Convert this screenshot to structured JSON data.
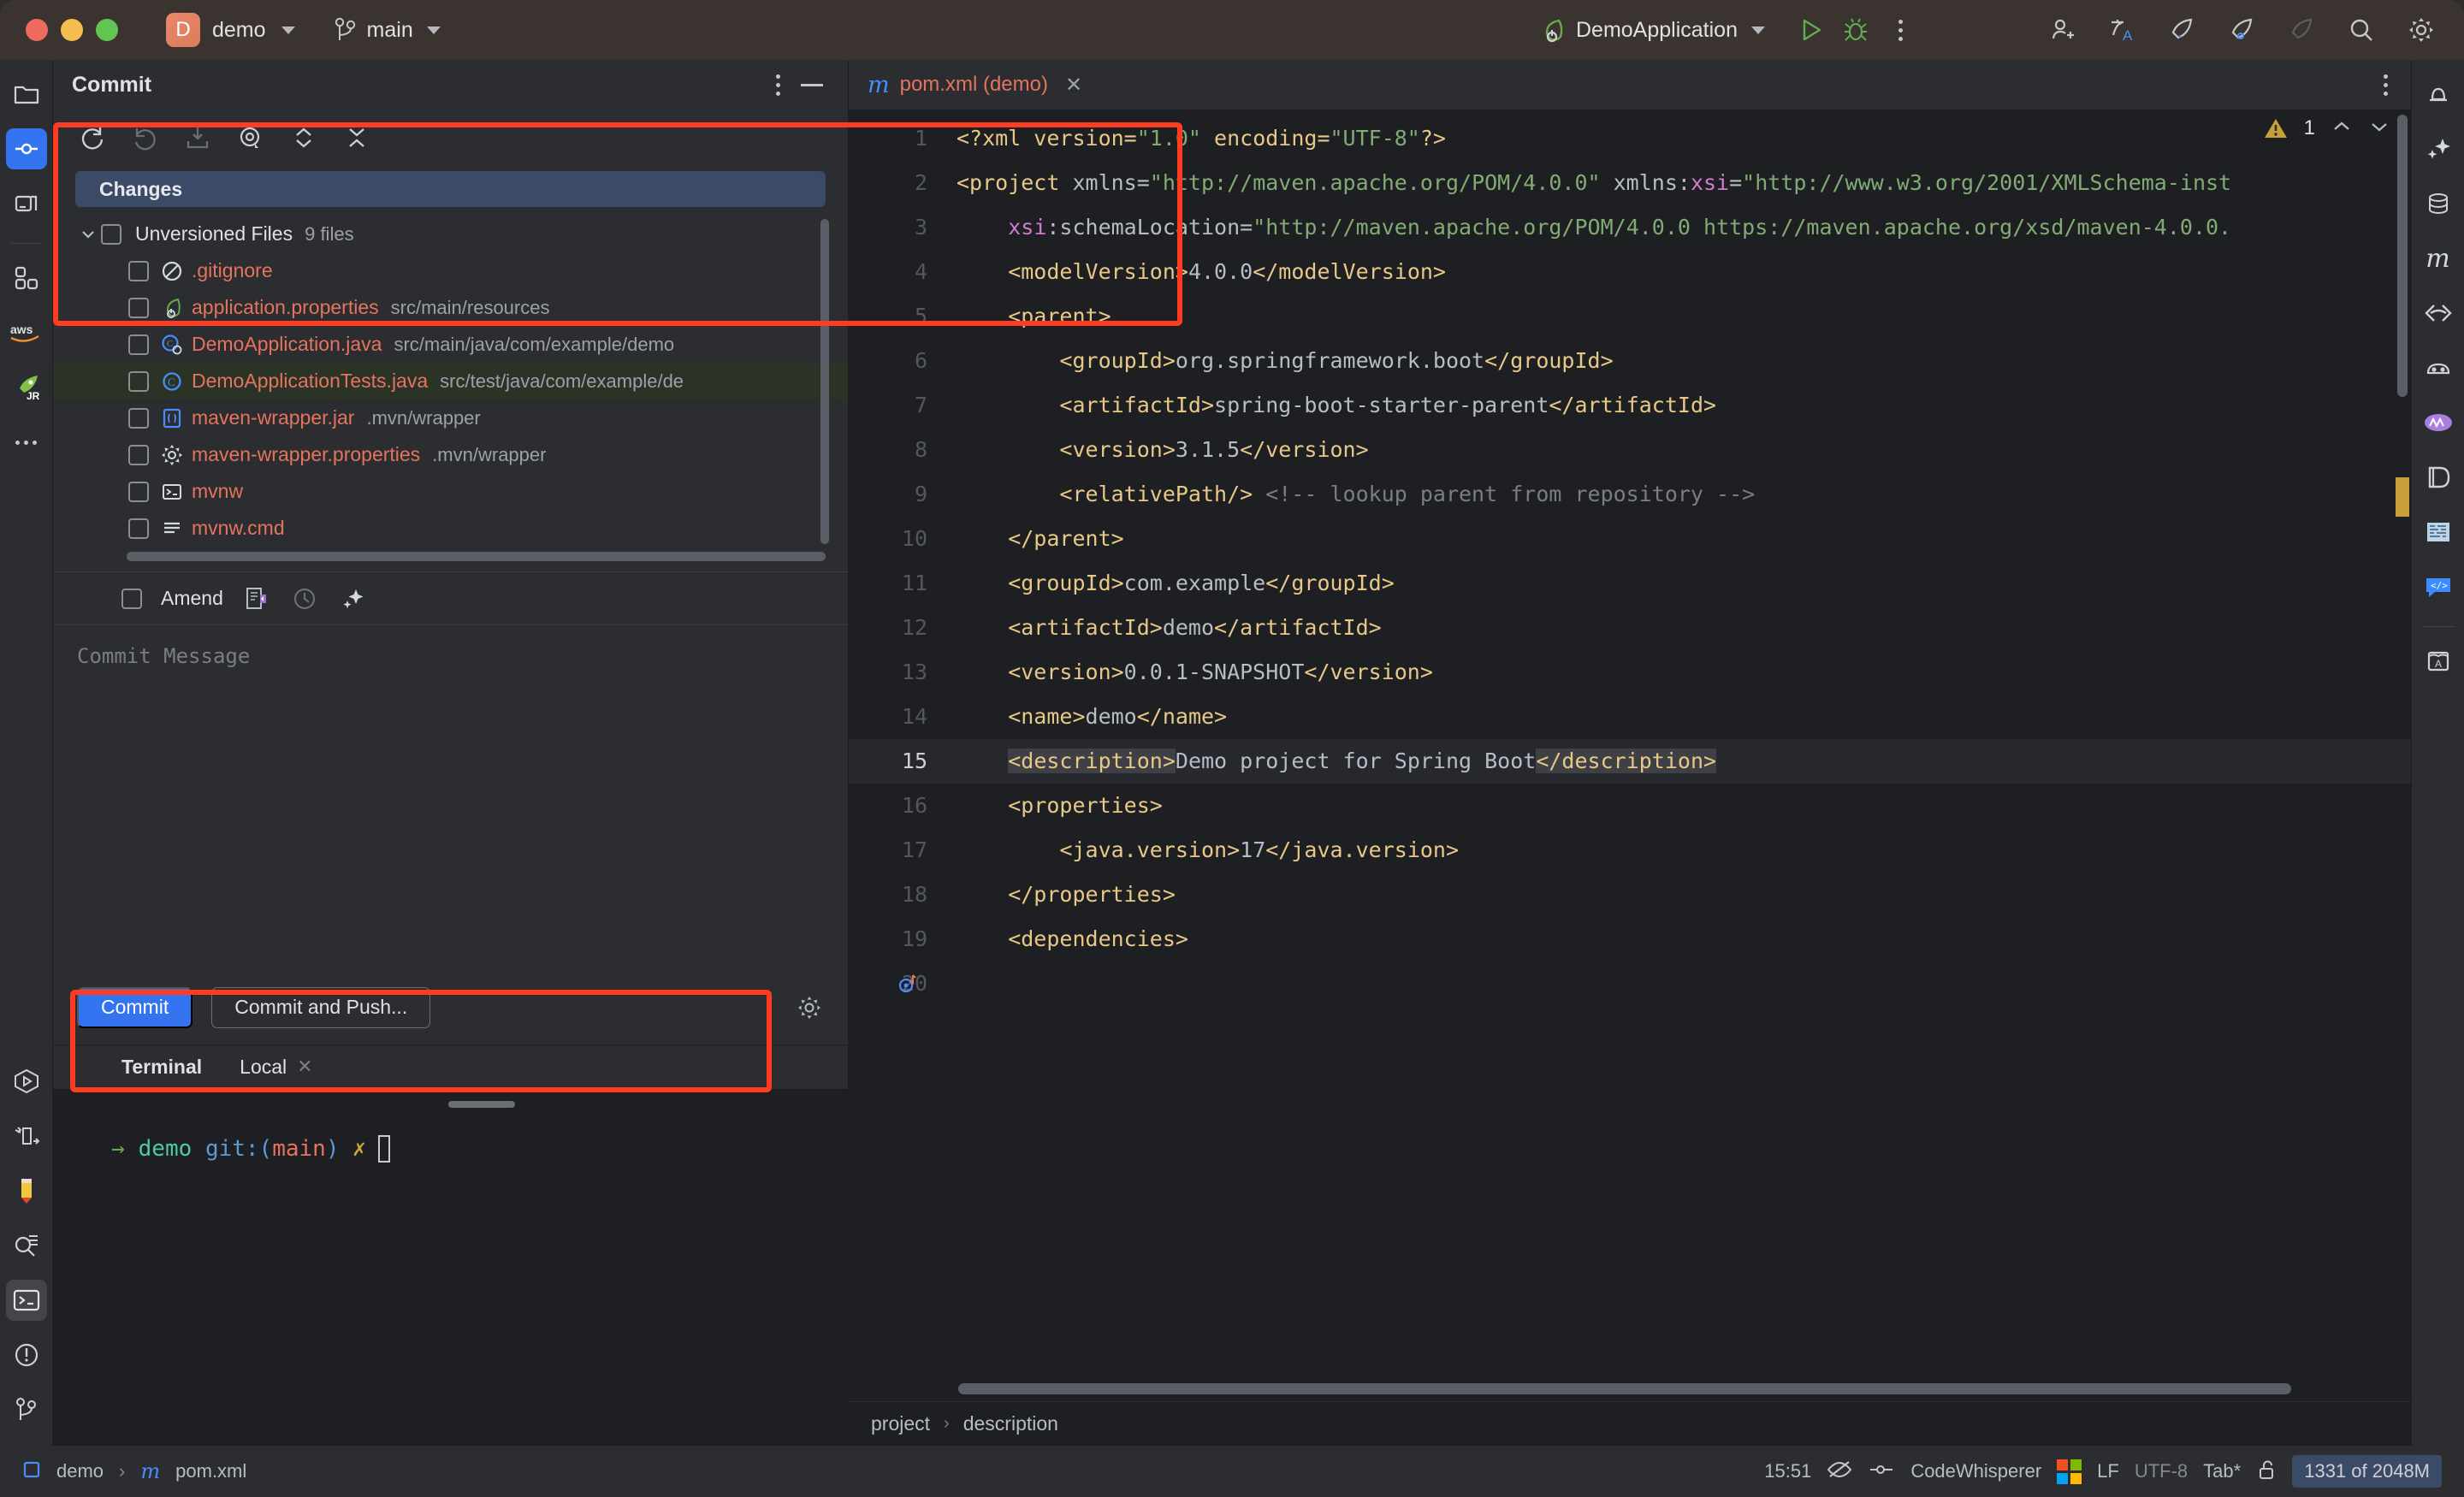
{
  "titlebar": {
    "project_badge": "D",
    "project_name": "demo",
    "branch_icon": "branch-icon",
    "branch_name": "main",
    "run_config": "DemoApplication",
    "run_icon": "run-icon",
    "debug_icon": "debug-icon",
    "more_icon": "more-options-icon",
    "right_icons": [
      {
        "name": "add-user-icon"
      },
      {
        "name": "translate-icon"
      },
      {
        "name": "rocket-run-icon"
      },
      {
        "name": "rocket-debug-icon"
      },
      {
        "name": "rocket-disabled-icon"
      },
      {
        "name": "search-icon"
      },
      {
        "name": "settings-gear-icon"
      }
    ]
  },
  "left_stripe": [
    {
      "name": "project-folder-icon",
      "selected": false
    },
    {
      "name": "commit-icon",
      "selected": true
    },
    {
      "name": "pull-requests-icon",
      "selected": false
    },
    {
      "name": "plugins-icon",
      "selected": false
    },
    {
      "name": "aws-toolkit-icon",
      "selected": false,
      "label": "aws"
    },
    {
      "name": "jetbrains-runtime-icon",
      "selected": false,
      "label": "JR"
    },
    {
      "name": "more-tool-windows-icon",
      "selected": false
    }
  ],
  "left_stripe_bottom": [
    {
      "name": "run-tool-icon",
      "selected": false
    },
    {
      "name": "debug-tool-icon",
      "selected": false
    },
    {
      "name": "edit-pencil-icon",
      "selected": false
    },
    {
      "name": "find-icon",
      "selected": false
    },
    {
      "name": "terminal-icon",
      "selected": true
    },
    {
      "name": "problems-icon",
      "selected": false
    },
    {
      "name": "git-branch-icon",
      "selected": false
    }
  ],
  "right_stripe": [
    {
      "name": "notifications-bell-icon"
    },
    {
      "name": "ai-assistant-icon"
    },
    {
      "name": "database-icon"
    },
    {
      "name": "maven-icon"
    },
    {
      "name": "endpoints-icon"
    },
    {
      "name": "gradle-icon"
    },
    {
      "name": "nx-console-icon"
    },
    {
      "name": "docker-icon"
    },
    {
      "name": "bitmap-icon"
    },
    {
      "name": "code-chat-icon"
    },
    {
      "name": "dictionary-icon"
    }
  ],
  "commit_panel": {
    "title": "Commit",
    "options_icon": "more-options-icon",
    "hide_icon": "hide-panel-icon",
    "toolbar": [
      {
        "name": "refresh-changes-icon"
      },
      {
        "name": "rollback-icon"
      },
      {
        "name": "shelve-icon"
      },
      {
        "name": "show-diff-icon"
      },
      {
        "name": "expand-collapse-icon"
      },
      {
        "name": "collapse-all-icon"
      }
    ],
    "changes_label": "Changes",
    "node": {
      "label": "Unversioned Files",
      "count": "9 files"
    },
    "files": [
      {
        "icon": "gitignore-icon",
        "name": ".gitignore",
        "path": "",
        "selected": false
      },
      {
        "icon": "spring-properties-icon",
        "name": "application.properties",
        "path": "src/main/resources",
        "selected": false
      },
      {
        "icon": "spring-class-icon",
        "name": "DemoApplication.java",
        "path": "src/main/java/com/example/demo",
        "selected": false
      },
      {
        "icon": "java-class-icon",
        "name": "DemoApplicationTests.java",
        "path": "src/test/java/com/example/de",
        "selected": true
      },
      {
        "icon": "jar-icon",
        "name": "maven-wrapper.jar",
        "path": ".mvn/wrapper",
        "selected": false
      },
      {
        "icon": "properties-icon",
        "name": "maven-wrapper.properties",
        "path": ".mvn/wrapper",
        "selected": false
      },
      {
        "icon": "shell-script-icon",
        "name": "mvnw",
        "path": "",
        "selected": false
      },
      {
        "icon": "text-file-icon",
        "name": "mvnw.cmd",
        "path": "",
        "selected": false
      }
    ],
    "amend_label": "Amend",
    "amend_icons": [
      {
        "name": "commit-options-icon"
      },
      {
        "name": "commit-history-icon"
      },
      {
        "name": "ai-generate-message-icon"
      }
    ],
    "message_placeholder": "Commit Message",
    "commit_button": "Commit",
    "commit_push_button": "Commit and Push...",
    "settings_icon": "commit-settings-gear-icon"
  },
  "terminal": {
    "tab_label": "Terminal",
    "session_label": "Local",
    "close_icon": "close-icon",
    "prompt": {
      "arrow": "→",
      "dir": "demo",
      "git_prefix": "git:(",
      "branch": "main",
      "git_suffix": ")",
      "dirty": "✗"
    }
  },
  "editor": {
    "tab": {
      "icon": "maven-file-icon",
      "label": "pom.xml (demo)",
      "close_icon": "close-tab-icon"
    },
    "warnings": {
      "icon": "warning-triangle-icon",
      "count": "1",
      "prev_icon": "previous-problem-icon",
      "next_icon": "next-problem-icon"
    },
    "breadcrumb": [
      "project",
      "description"
    ],
    "line_numbers": [
      "1",
      "2",
      "3",
      "4",
      "5",
      "6",
      "7",
      "8",
      "9",
      "10",
      "11",
      "12",
      "13",
      "14",
      "15",
      "16",
      "17",
      "18",
      "19",
      "20"
    ],
    "current_line": 15,
    "lines": [
      {
        "n": 1,
        "segments": [
          {
            "t": "<?xml version=",
            "c": "tag"
          },
          {
            "t": "\"1.0\"",
            "c": "str"
          },
          {
            "t": " encoding=",
            "c": "tag"
          },
          {
            "t": "\"UTF-8\"",
            "c": "str"
          },
          {
            "t": "?>",
            "c": "tag"
          }
        ]
      },
      {
        "n": 2,
        "segments": [
          {
            "t": "<project ",
            "c": "tag"
          },
          {
            "t": "xmlns=",
            "c": "attr2"
          },
          {
            "t": "\"http://maven.apache.org/POM/4.0.0\"",
            "c": "str"
          },
          {
            "t": " xmlns:",
            "c": "attr2"
          },
          {
            "t": "xsi",
            "c": "attr"
          },
          {
            "t": "=",
            "c": "attr2"
          },
          {
            "t": "\"http://www.w3.org/2001/XMLSchema-inst",
            "c": "str"
          }
        ]
      },
      {
        "n": 3,
        "segments": [
          {
            "t": "    ",
            "c": "txt"
          },
          {
            "t": "xsi",
            "c": "attr"
          },
          {
            "t": ":schemaLocation=",
            "c": "attr2"
          },
          {
            "t": "\"http://maven.apache.org/POM/4.0.0 https://maven.apache.org/xsd/maven-4.0.0.",
            "c": "str"
          }
        ]
      },
      {
        "n": 4,
        "segments": [
          {
            "t": "    <modelVersion>",
            "c": "tag"
          },
          {
            "t": "4.0.0",
            "c": "txt"
          },
          {
            "t": "</modelVersion>",
            "c": "tag"
          }
        ]
      },
      {
        "n": 5,
        "segments": [
          {
            "t": "    <parent>",
            "c": "tag"
          }
        ]
      },
      {
        "n": 6,
        "segments": [
          {
            "t": "        <groupId>",
            "c": "tag"
          },
          {
            "t": "org.springframework.boot",
            "c": "txt"
          },
          {
            "t": "</groupId>",
            "c": "tag"
          }
        ]
      },
      {
        "n": 7,
        "segments": [
          {
            "t": "        <artifactId>",
            "c": "tag"
          },
          {
            "t": "spring-boot-starter-parent",
            "c": "txt"
          },
          {
            "t": "</artifactId>",
            "c": "tag"
          }
        ]
      },
      {
        "n": 8,
        "segments": [
          {
            "t": "        <version>",
            "c": "tag"
          },
          {
            "t": "3.1.5",
            "c": "txt"
          },
          {
            "t": "</version>",
            "c": "tag"
          }
        ]
      },
      {
        "n": 9,
        "segments": [
          {
            "t": "        <relativePath/>",
            "c": "tag"
          },
          {
            "t": " <!-- lookup parent from repository -->",
            "c": "cmt"
          }
        ]
      },
      {
        "n": 10,
        "segments": [
          {
            "t": "    </parent>",
            "c": "tag"
          }
        ]
      },
      {
        "n": 11,
        "segments": [
          {
            "t": "    <groupId>",
            "c": "tag"
          },
          {
            "t": "com.example",
            "c": "txt"
          },
          {
            "t": "</groupId>",
            "c": "tag"
          }
        ]
      },
      {
        "n": 12,
        "segments": [
          {
            "t": "    <artifactId>",
            "c": "tag"
          },
          {
            "t": "demo",
            "c": "txt"
          },
          {
            "t": "</artifactId>",
            "c": "tag"
          }
        ]
      },
      {
        "n": 13,
        "segments": [
          {
            "t": "    <version>",
            "c": "tag"
          },
          {
            "t": "0.0.1-SNAPSHOT",
            "c": "txt"
          },
          {
            "t": "</version>",
            "c": "tag"
          }
        ]
      },
      {
        "n": 14,
        "segments": [
          {
            "t": "    <name>",
            "c": "tag"
          },
          {
            "t": "demo",
            "c": "txt"
          },
          {
            "t": "</name>",
            "c": "tag"
          }
        ]
      },
      {
        "n": 15,
        "segments": [
          {
            "t": "    ",
            "c": "txt"
          },
          {
            "t": "<description>",
            "c": "tag hl"
          },
          {
            "t": "Demo project for Spring Boot",
            "c": "txt"
          },
          {
            "t": "</description>",
            "c": "tag hl"
          }
        ]
      },
      {
        "n": 16,
        "segments": [
          {
            "t": "    <properties>",
            "c": "tag"
          }
        ]
      },
      {
        "n": 17,
        "segments": [
          {
            "t": "        <java.version>",
            "c": "tag"
          },
          {
            "t": "17",
            "c": "txt"
          },
          {
            "t": "</java.version>",
            "c": "tag"
          }
        ]
      },
      {
        "n": 18,
        "segments": [
          {
            "t": "    </properties>",
            "c": "tag"
          }
        ]
      },
      {
        "n": 19,
        "segments": [
          {
            "t": "    <dependencies>",
            "c": "tag"
          }
        ]
      },
      {
        "n": 20,
        "segments": []
      }
    ]
  },
  "statusbar": {
    "project": "demo",
    "file_icon": "maven-file-icon",
    "file": "pom.xml",
    "separator": "›",
    "time": "15:51",
    "eye_icon": "reader-mode-off-icon",
    "codewhisperer_icon": "codewhisperer-icon",
    "codewhisperer": "CodeWhisperer",
    "windows_icon": "windows-icon",
    "line_sep": "LF",
    "encoding": "UTF-8",
    "indent": "Tab*",
    "lock_icon": "unlocked-icon",
    "memory": "1331 of 2048M"
  },
  "colors": {
    "accent_blue": "#3574f0",
    "selection_band": "#3b4a66",
    "file_red": "#e4745e",
    "tag_yellow": "#e8c887",
    "string_green": "#82ab74",
    "annotation_red": "#ff3b21",
    "warning_yellow": "#c8a03a"
  }
}
